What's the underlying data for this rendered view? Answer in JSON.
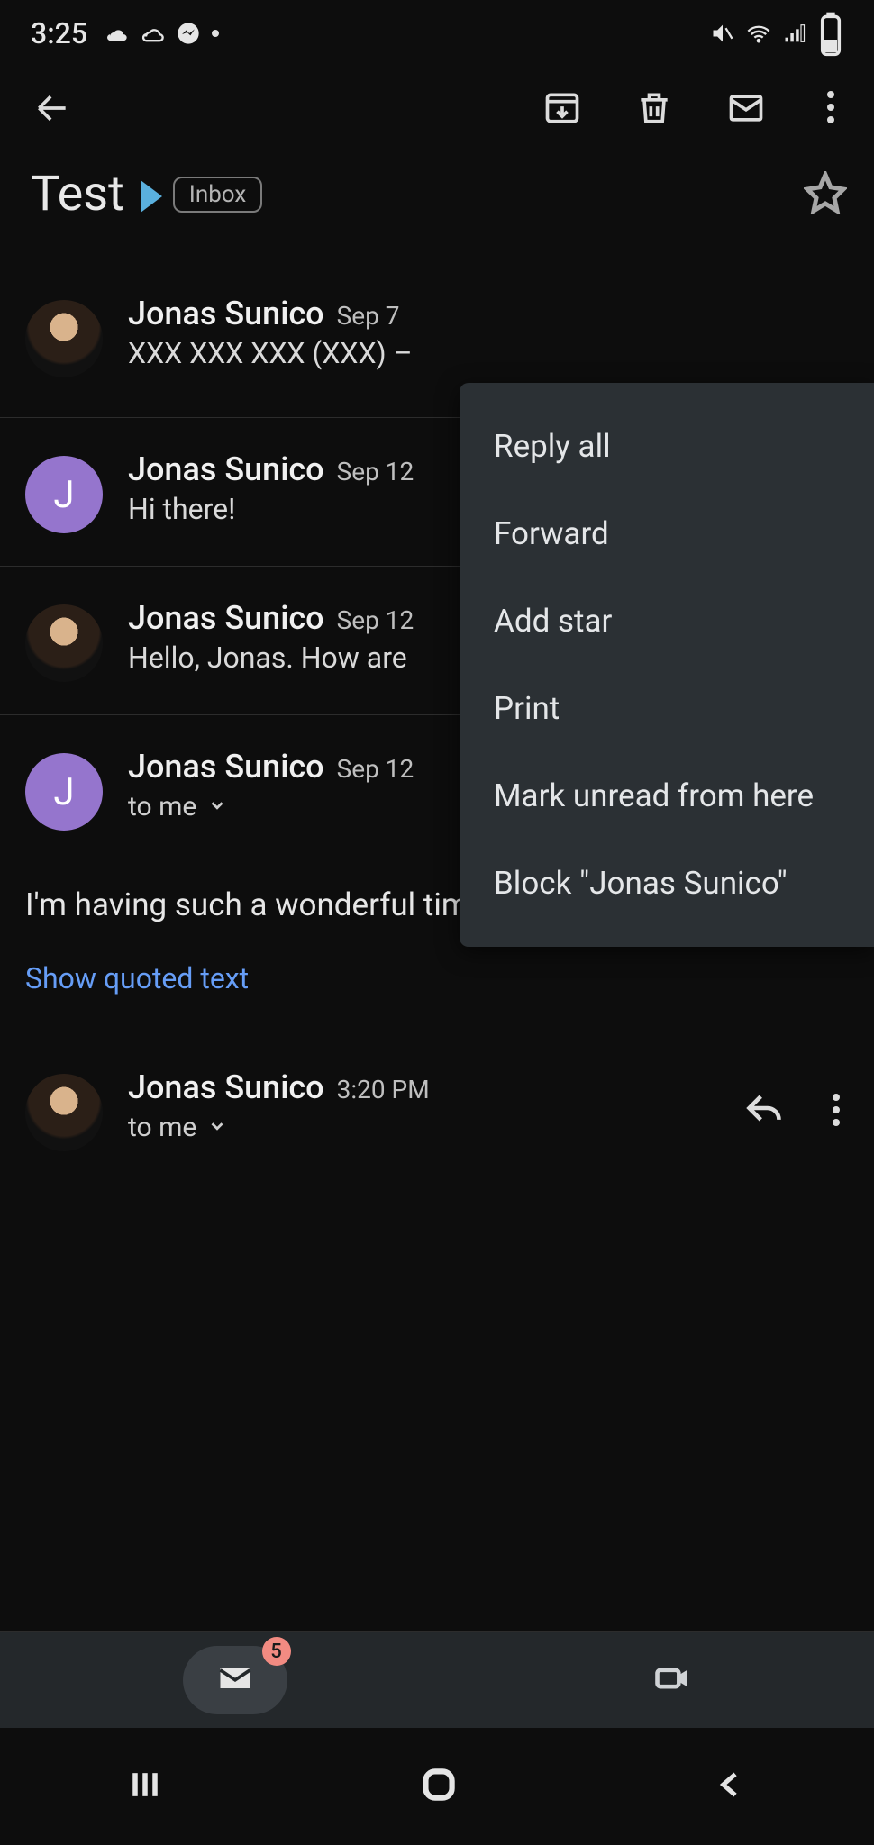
{
  "status": {
    "time": "3:25"
  },
  "toolbar": {},
  "subject": {
    "title": "Test",
    "label": "Inbox"
  },
  "thread": [
    {
      "sender": "Jonas Sunico",
      "date": "Sep 7",
      "preview": "XXX XXX XXX (XXX) –"
    },
    {
      "sender": "Jonas Sunico",
      "date": "Sep 12",
      "preview": "Hi there!"
    },
    {
      "sender": "Jonas Sunico",
      "date": "Sep 12",
      "preview": "Hello, Jonas. How are"
    },
    {
      "sender": "Jonas Sunico",
      "date": "Sep 12",
      "to": "to me",
      "body": "I'm having such a wonderful time!",
      "show_quoted": "Show quoted text"
    },
    {
      "sender": "Jonas Sunico",
      "date": "3:20 PM",
      "to": "to me"
    }
  ],
  "popup": {
    "items": [
      "Reply all",
      "Forward",
      "Add star",
      "Print",
      "Mark unread from here",
      "Block \"Jonas Sunico\""
    ]
  },
  "tabs": {
    "mail_badge": "5"
  },
  "avatar_letter": "J"
}
